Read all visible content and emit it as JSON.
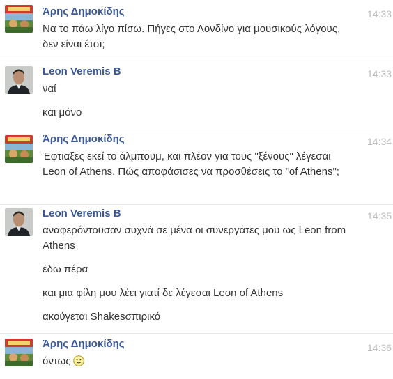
{
  "messages": [
    {
      "sender": "Άρης Δημοκίδης",
      "time": "14:33",
      "avatar": "aris-avatar",
      "lines": [
        "Να το πάω λίγο πίσω. Πήγες στο Λονδίνο για μουσικούς λόγους, δεν είναι έτσι;"
      ]
    },
    {
      "sender": "Leon Veremis B",
      "time": "14:33",
      "avatar": "leon-avatar",
      "lines": [
        "ναί",
        "και μόνο"
      ]
    },
    {
      "sender": "Άρης Δημοκίδης",
      "time": "14:34",
      "avatar": "aris-avatar",
      "lines": [
        "Έφτιαξες εκεί το άλμπουμ, και πλέον για τους \"ξένους\" λέγεσαι Leon of Athens. Πώς αποφάσισες να προσθέσεις το \"of Athens\";"
      ]
    },
    {
      "sender": "Leon Veremis B",
      "time": "14:35",
      "avatar": "leon-avatar",
      "lines": [
        "αναφερόντουσαν συχνά σε μένα οι συνεργάτες μου ως Leon from Athens",
        "εδω πέρα",
        "και μια φίλη μου λέει γιατί δε λέγεσαι Leon of Athens",
        "ακούγεται Shakesσπιρικό"
      ]
    },
    {
      "sender": "Άρης Δημοκίδης",
      "time": "14:36",
      "avatar": "aris-avatar",
      "lines": [
        "όντως"
      ],
      "emoji": "smiley-icon"
    }
  ],
  "colors": {
    "sender": "#3b5998",
    "text": "#333333",
    "time": "#bdbdbd",
    "separator": "#e9eaed"
  }
}
